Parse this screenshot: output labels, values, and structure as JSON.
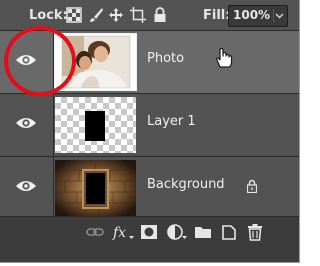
{
  "toolbar": {
    "lock_label": "Lock:",
    "fill_label": "Fill:",
    "fill_value": "100%",
    "lock_icons": [
      "lock-transparent-pixels-icon",
      "lock-image-pixels-icon",
      "lock-position-icon",
      "lock-artboard-icon",
      "lock-all-icon"
    ]
  },
  "layers": [
    {
      "name": "Photo",
      "visible": true,
      "selected": true,
      "locked": false,
      "thumb": "photo-of-couple"
    },
    {
      "name": "Layer 1",
      "visible": true,
      "selected": false,
      "locked": false,
      "thumb": "black-rectangle-on-transparent"
    },
    {
      "name": "Background",
      "visible": true,
      "selected": false,
      "locked": true,
      "thumb": "framed-black-rectangle-on-stone-wall"
    }
  ],
  "bottom_icons": [
    "link-layers-icon",
    "fx-icon",
    "add-mask-icon",
    "adjustment-layer-icon",
    "new-group-icon",
    "new-layer-icon",
    "delete-layer-icon"
  ],
  "annotation": {
    "color": "#e20f1b",
    "target": "Photo visibility eye"
  },
  "colors": {
    "panel": "#535353",
    "selected_row": "#696969",
    "background": "#2f2f2f"
  }
}
